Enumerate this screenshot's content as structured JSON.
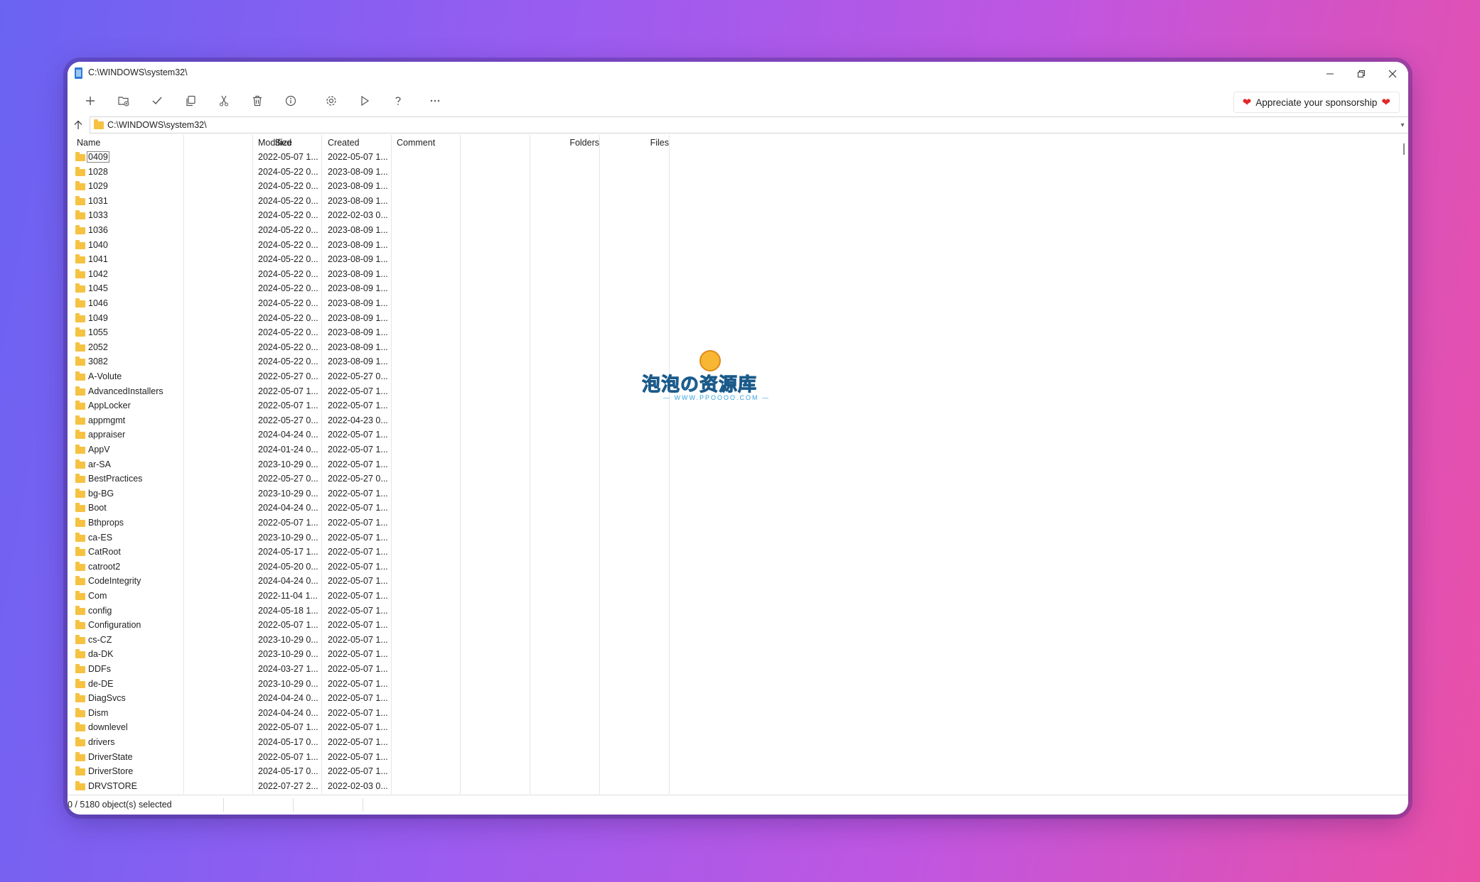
{
  "window": {
    "title": "C:\\WINDOWS\\system32\\"
  },
  "toolbar": {
    "buttons": [
      "new-icon",
      "new-folder-icon",
      "check-icon",
      "copy-icon",
      "cut-icon",
      "delete-icon",
      "info-icon",
      "settings-icon",
      "play-icon",
      "help-icon",
      "more-icon"
    ],
    "sponsor_label": "Appreciate your sponsorship"
  },
  "address": {
    "path": "C:\\WINDOWS\\system32\\"
  },
  "columns": {
    "name": "Name",
    "size": "Size",
    "modified": "Modified",
    "created": "Created",
    "comment": "Comment",
    "folders": "Folders",
    "files": "Files"
  },
  "rows": [
    {
      "name": "0409",
      "modified": "2022-05-07 1...",
      "created": "2022-05-07 1..."
    },
    {
      "name": "1028",
      "modified": "2024-05-22 0...",
      "created": "2023-08-09 1..."
    },
    {
      "name": "1029",
      "modified": "2024-05-22 0...",
      "created": "2023-08-09 1..."
    },
    {
      "name": "1031",
      "modified": "2024-05-22 0...",
      "created": "2023-08-09 1..."
    },
    {
      "name": "1033",
      "modified": "2024-05-22 0...",
      "created": "2022-02-03 0..."
    },
    {
      "name": "1036",
      "modified": "2024-05-22 0...",
      "created": "2023-08-09 1..."
    },
    {
      "name": "1040",
      "modified": "2024-05-22 0...",
      "created": "2023-08-09 1..."
    },
    {
      "name": "1041",
      "modified": "2024-05-22 0...",
      "created": "2023-08-09 1..."
    },
    {
      "name": "1042",
      "modified": "2024-05-22 0...",
      "created": "2023-08-09 1..."
    },
    {
      "name": "1045",
      "modified": "2024-05-22 0...",
      "created": "2023-08-09 1..."
    },
    {
      "name": "1046",
      "modified": "2024-05-22 0...",
      "created": "2023-08-09 1..."
    },
    {
      "name": "1049",
      "modified": "2024-05-22 0...",
      "created": "2023-08-09 1..."
    },
    {
      "name": "1055",
      "modified": "2024-05-22 0...",
      "created": "2023-08-09 1..."
    },
    {
      "name": "2052",
      "modified": "2024-05-22 0...",
      "created": "2023-08-09 1..."
    },
    {
      "name": "3082",
      "modified": "2024-05-22 0...",
      "created": "2023-08-09 1..."
    },
    {
      "name": "A-Volute",
      "modified": "2022-05-27 0...",
      "created": "2022-05-27 0..."
    },
    {
      "name": "AdvancedInstallers",
      "modified": "2022-05-07 1...",
      "created": "2022-05-07 1..."
    },
    {
      "name": "AppLocker",
      "modified": "2022-05-07 1...",
      "created": "2022-05-07 1..."
    },
    {
      "name": "appmgmt",
      "modified": "2022-05-27 0...",
      "created": "2022-04-23 0..."
    },
    {
      "name": "appraiser",
      "modified": "2024-04-24 0...",
      "created": "2022-05-07 1..."
    },
    {
      "name": "AppV",
      "modified": "2024-01-24 0...",
      "created": "2022-05-07 1..."
    },
    {
      "name": "ar-SA",
      "modified": "2023-10-29 0...",
      "created": "2022-05-07 1..."
    },
    {
      "name": "BestPractices",
      "modified": "2022-05-27 0...",
      "created": "2022-05-27 0..."
    },
    {
      "name": "bg-BG",
      "modified": "2023-10-29 0...",
      "created": "2022-05-07 1..."
    },
    {
      "name": "Boot",
      "modified": "2024-04-24 0...",
      "created": "2022-05-07 1..."
    },
    {
      "name": "Bthprops",
      "modified": "2022-05-07 1...",
      "created": "2022-05-07 1..."
    },
    {
      "name": "ca-ES",
      "modified": "2023-10-29 0...",
      "created": "2022-05-07 1..."
    },
    {
      "name": "CatRoot",
      "modified": "2024-05-17 1...",
      "created": "2022-05-07 1..."
    },
    {
      "name": "catroot2",
      "modified": "2024-05-20 0...",
      "created": "2022-05-07 1..."
    },
    {
      "name": "CodeIntegrity",
      "modified": "2024-04-24 0...",
      "created": "2022-05-07 1..."
    },
    {
      "name": "Com",
      "modified": "2022-11-04 1...",
      "created": "2022-05-07 1..."
    },
    {
      "name": "config",
      "modified": "2024-05-18 1...",
      "created": "2022-05-07 1..."
    },
    {
      "name": "Configuration",
      "modified": "2022-05-07 1...",
      "created": "2022-05-07 1..."
    },
    {
      "name": "cs-CZ",
      "modified": "2023-10-29 0...",
      "created": "2022-05-07 1..."
    },
    {
      "name": "da-DK",
      "modified": "2023-10-29 0...",
      "created": "2022-05-07 1..."
    },
    {
      "name": "DDFs",
      "modified": "2024-03-27 1...",
      "created": "2022-05-07 1..."
    },
    {
      "name": "de-DE",
      "modified": "2023-10-29 0...",
      "created": "2022-05-07 1..."
    },
    {
      "name": "DiagSvcs",
      "modified": "2024-04-24 0...",
      "created": "2022-05-07 1..."
    },
    {
      "name": "Dism",
      "modified": "2024-04-24 0...",
      "created": "2022-05-07 1..."
    },
    {
      "name": "downlevel",
      "modified": "2022-05-07 1...",
      "created": "2022-05-07 1..."
    },
    {
      "name": "drivers",
      "modified": "2024-05-17 0...",
      "created": "2022-05-07 1..."
    },
    {
      "name": "DriverState",
      "modified": "2022-05-07 1...",
      "created": "2022-05-07 1..."
    },
    {
      "name": "DriverStore",
      "modified": "2024-05-17 0...",
      "created": "2022-05-07 1..."
    },
    {
      "name": "DRVSTORE",
      "modified": "2022-07-27 2...",
      "created": "2022-02-03 0..."
    }
  ],
  "status": {
    "selection": "0 / 5180 object(s) selected"
  },
  "watermark": {
    "main": "泡泡の资源库",
    "url": "— WWW.PPOOOO.COM —"
  }
}
